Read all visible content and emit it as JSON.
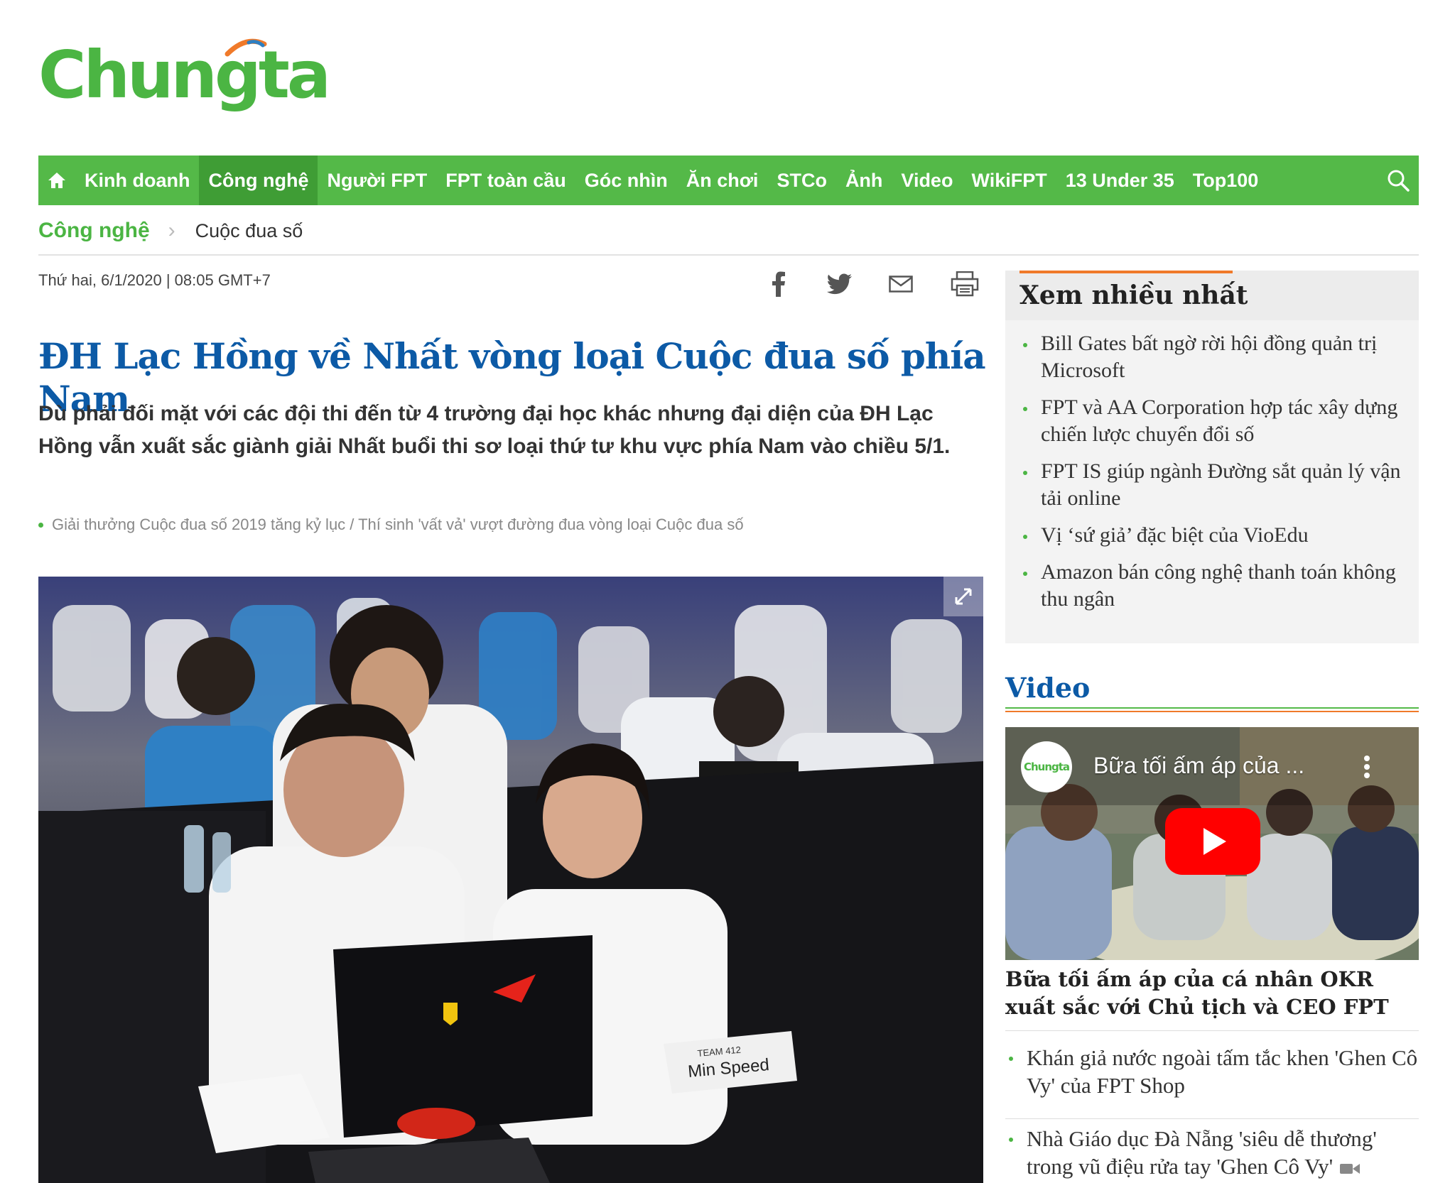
{
  "logo": {
    "text": "Chungta"
  },
  "nav": {
    "items": [
      "Kinh doanh",
      "Công nghệ",
      "Người FPT",
      "FPT toàn cầu",
      "Góc nhìn",
      "Ăn chơi",
      "STCo",
      "Ảnh",
      "Video",
      "WikiFPT",
      "13 Under 35",
      "Top100"
    ],
    "active": "Công nghệ"
  },
  "breadcrumb": {
    "category": "Công nghệ",
    "subcategory": "Cuộc đua số"
  },
  "article": {
    "date": "Thứ hai, 6/1/2020 | 08:05 GMT+7",
    "title": "ĐH Lạc Hồng về Nhất vòng loại Cuộc đua số phía Nam",
    "lead": "Dù phải đối mặt với các đội thi đến từ 4 trường đại học khác nhưng đại diện của ĐH Lạc Hồng vẫn xuất sắc giành giải Nhất buổi thi sơ loại thứ tư khu vực phía Nam vào chiều 5/1.",
    "related": "Giải thưởng Cuộc đua số 2019 tăng kỷ lục / Thí sinh 'vất vả' vượt đường đua vòng loại Cuộc đua số",
    "photo_labels": {
      "team": "TEAM 412",
      "name": "Min Speed"
    }
  },
  "share_icons": [
    "facebook-icon",
    "twitter-icon",
    "mail-icon",
    "print-icon"
  ],
  "most_viewed": {
    "title": "Xem nhiều nhất",
    "items": [
      "Bill Gates bất ngờ rời hội đồng quản trị Microsoft",
      "FPT và AA Corporation hợp tác xây dựng chiến lược chuyển đổi số",
      "FPT IS giúp ngành Đường sắt quản lý vận tải online",
      "Vị ‘sứ giả’ đặc biệt của VioEdu",
      "Amazon bán công nghệ thanh toán không thu ngân"
    ]
  },
  "video": {
    "section_title": "Video",
    "player_channel": "Chungta",
    "player_title": "Bữa tối ấm áp của ...",
    "caption": "Bữa tối ấm áp của cá nhân OKR xuất sắc với Chủ tịch và CEO FPT",
    "items": [
      "Khán giả nước ngoài tấm tắc khen 'Ghen Cô Vy' của FPT Shop",
      "Nhà Giáo dục Đà Nẵng 'siêu dễ thương' trong vũ điệu rửa tay 'Ghen Cô Vy'"
    ]
  },
  "colors": {
    "brand_green": "#54b948",
    "title_blue": "#0c5aa6",
    "accent_orange": "#f07a2a"
  }
}
